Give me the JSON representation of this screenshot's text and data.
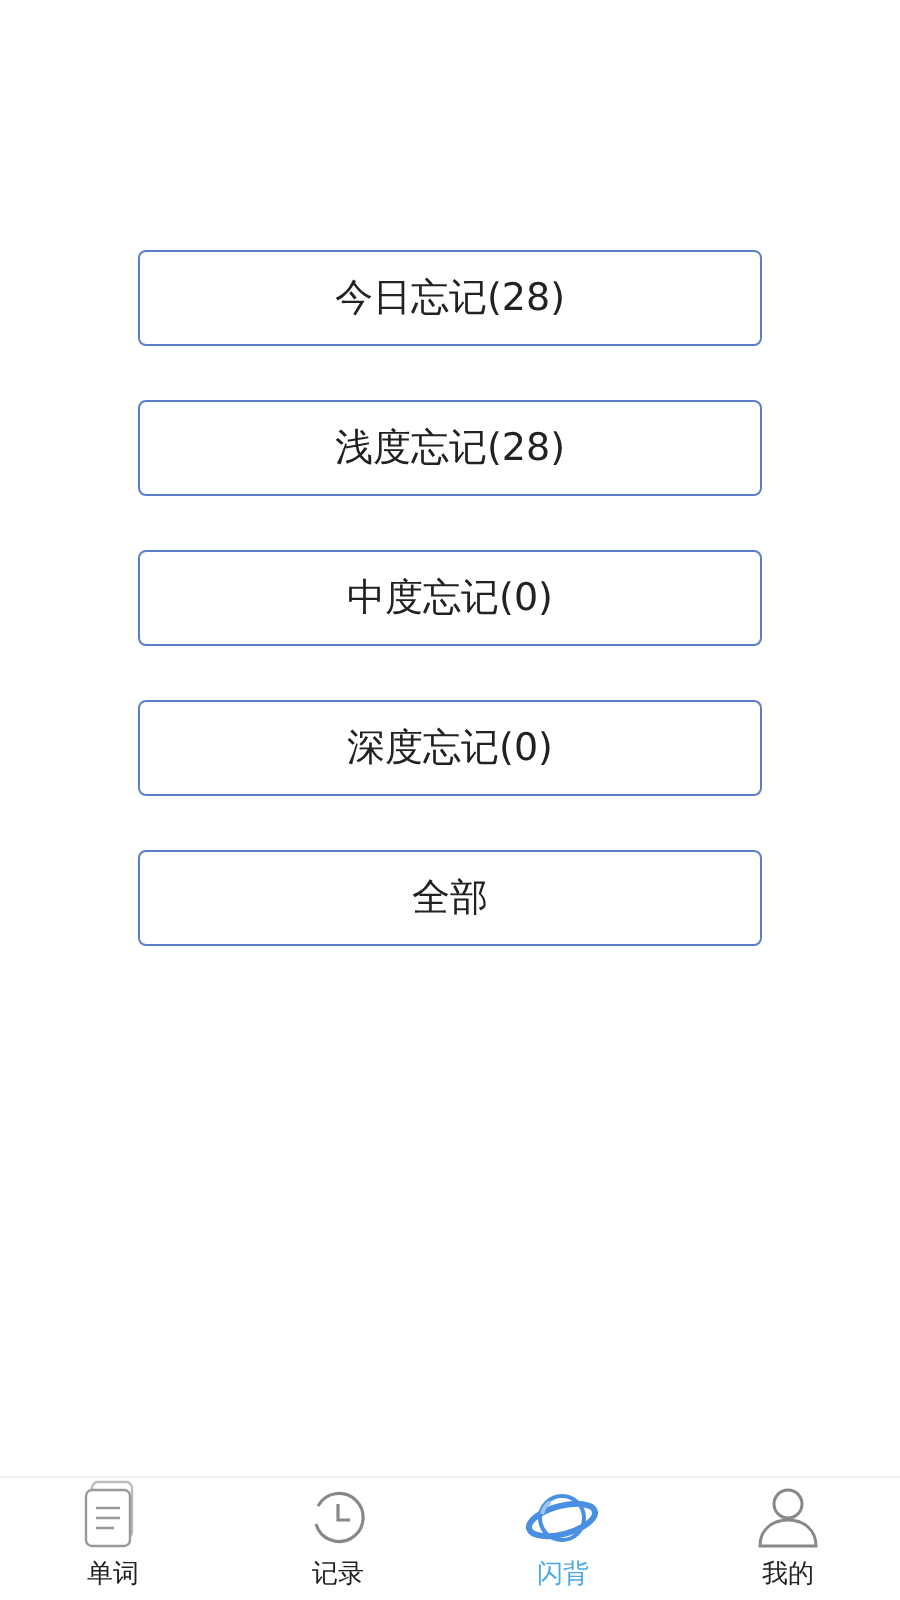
{
  "buttons": [
    {
      "label": "今日忘记(28)"
    },
    {
      "label": "浅度忘记(28)"
    },
    {
      "label": "中度忘记(0)"
    },
    {
      "label": "深度忘记(0)"
    },
    {
      "label": "全部"
    }
  ],
  "tab_bar": [
    {
      "label": "单词",
      "kind": "words",
      "selected": false
    },
    {
      "label": "记录",
      "kind": "history",
      "selected": false
    },
    {
      "label": "闪背",
      "kind": "planet",
      "selected": true
    },
    {
      "label": "我的",
      "kind": "profile",
      "selected": false
    }
  ]
}
